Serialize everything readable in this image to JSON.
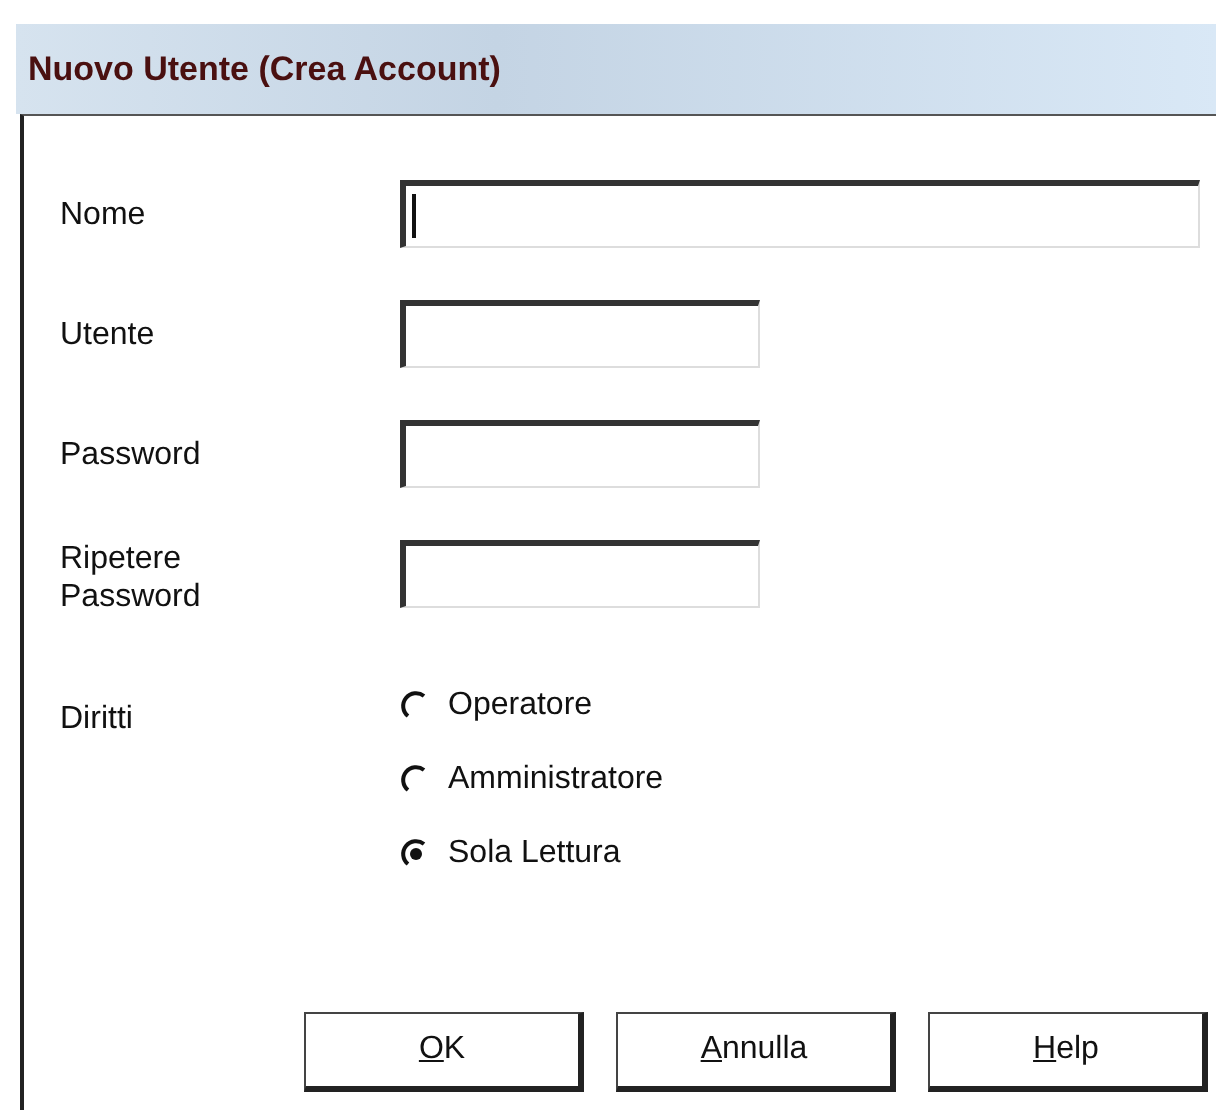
{
  "window": {
    "title": "Nuovo Utente (Crea Account)"
  },
  "fields": [
    {
      "label": "Nome",
      "wide": true,
      "focused": true
    },
    {
      "label": "Utente",
      "wide": false,
      "focused": false
    },
    {
      "label": "Password",
      "wide": false,
      "focused": false
    },
    {
      "label": "Ripetere Password",
      "wide": false,
      "focused": false
    }
  ],
  "rights": {
    "label": "Diritti",
    "options": [
      {
        "label": "Operatore",
        "selected": false
      },
      {
        "label": "Amministratore",
        "selected": false
      },
      {
        "label": "Sola Lettura",
        "selected": true
      }
    ]
  },
  "buttons": [
    "OK",
    "Annulla",
    "Help"
  ]
}
